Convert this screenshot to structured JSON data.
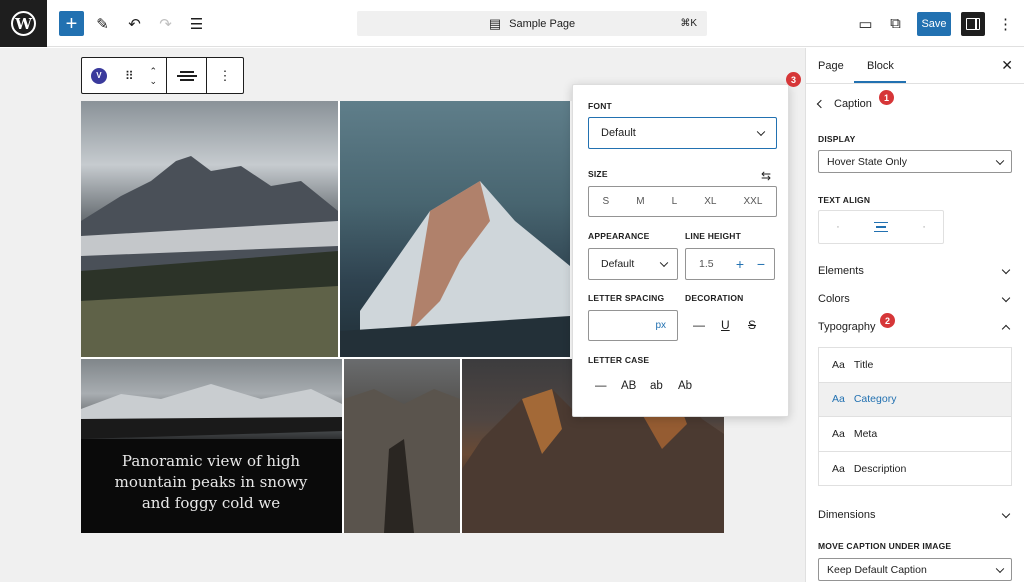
{
  "toolbar": {
    "document_title": "Sample Page",
    "shortcut": "⌘K",
    "save_label": "Save"
  },
  "block_toolbar": {
    "block_badge": "V"
  },
  "gallery": {
    "caption": "Panoramic view of high mountain peaks in snowy and foggy cold we"
  },
  "popover": {
    "font_label": "FONT",
    "font_value": "Default",
    "size_label": "SIZE",
    "sizes": [
      "S",
      "M",
      "L",
      "XL",
      "XXL"
    ],
    "appearance_label": "APPEARANCE",
    "appearance_value": "Default",
    "line_height_label": "LINE HEIGHT",
    "line_height_value": "1.5",
    "letter_spacing_label": "LETTER SPACING",
    "letter_spacing_unit": "px",
    "decoration_label": "DECORATION",
    "letter_case_label": "LETTER CASE",
    "letter_case": [
      "—",
      "AB",
      "ab",
      "Ab"
    ]
  },
  "badges": [
    "1",
    "2",
    "3"
  ],
  "sidebar": {
    "tab_page": "Page",
    "tab_block": "Block",
    "back_label": "Caption",
    "display_label": "DISPLAY",
    "display_value": "Hover State Only",
    "text_align_label": "TEXT ALIGN",
    "elements_label": "Elements",
    "colors_label": "Colors",
    "typography_label": "Typography",
    "typography_items": [
      {
        "aa": "Aa",
        "label": "Title"
      },
      {
        "aa": "Aa",
        "label": "Category"
      },
      {
        "aa": "Aa",
        "label": "Meta"
      },
      {
        "aa": "Aa",
        "label": "Description"
      }
    ],
    "dimensions_label": "Dimensions",
    "move_caption_label": "MOVE CAPTION UNDER IMAGE",
    "move_caption_value": "Keep Default Caption"
  },
  "colors": {
    "accent": "#2271b1",
    "badge": "#d63638",
    "dark": "#1e1e1e"
  }
}
